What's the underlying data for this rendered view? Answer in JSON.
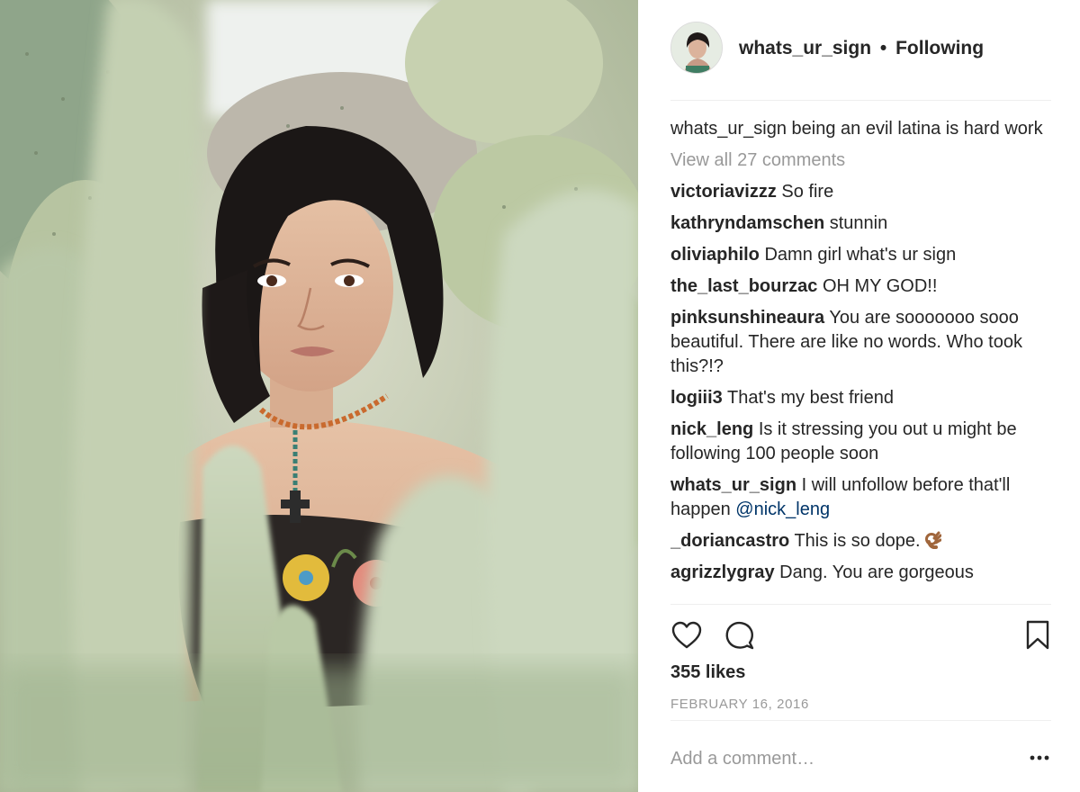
{
  "post": {
    "photo_alt": "Woman with dark bob among cacti"
  },
  "header": {
    "username": "whats_ur_sign",
    "separator": "•",
    "follow_status": "Following"
  },
  "caption": {
    "username": "whats_ur_sign",
    "text": " being an evil latina is hard work"
  },
  "view_all": "View all 27 comments",
  "comments": [
    {
      "user": "victoriavizzz",
      "text": " So fire"
    },
    {
      "user": "kathryndamschen",
      "text": " stunnin"
    },
    {
      "user": "oliviaphilo",
      "text": " Damn girl what's ur sign"
    },
    {
      "user": "the_last_bourzac",
      "text": " OH MY GOD!!"
    },
    {
      "user": "pinksunshineaura",
      "text": " You are sooooooo sooo beautiful. There are like no words. Who took this?!?"
    },
    {
      "user": "logiii3",
      "text": " That's my best friend"
    },
    {
      "user": "nick_leng",
      "text": " Is it stressing you out u might be following 100 people soon"
    },
    {
      "user": "whats_ur_sign",
      "text": " I will unfollow before that'll happen ",
      "mention": "@nick_leng"
    },
    {
      "user": "_doriancastro",
      "text": " This is so dope. ",
      "emoji": "ok-hand-emoji"
    },
    {
      "user": "agrizzlygray",
      "text": " Dang. You are gorgeous"
    }
  ],
  "actions": {
    "like_icon": "heart-icon",
    "comment_icon": "comment-bubble-icon",
    "save_icon": "bookmark-icon"
  },
  "likes": "355 likes",
  "date": "FEBRUARY 16, 2016",
  "add_comment": {
    "placeholder": "Add a comment…",
    "more_icon": "more-options-icon"
  },
  "colors": {
    "text": "#262626",
    "muted": "#999999",
    "mention": "#003569",
    "divider": "#efefef"
  }
}
